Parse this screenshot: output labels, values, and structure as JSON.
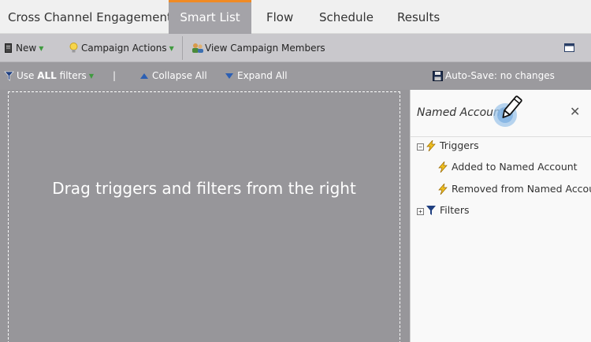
{
  "tabs": [
    {
      "label": "Cross Channel Engagement",
      "active": false
    },
    {
      "label": "Smart List",
      "active": true
    },
    {
      "label": "Flow",
      "active": false
    },
    {
      "label": "Schedule",
      "active": false
    },
    {
      "label": "Results",
      "active": false
    }
  ],
  "toolbar": {
    "new_label": "New",
    "campaign_actions_label": "Campaign Actions",
    "view_members_label": "View Campaign Members"
  },
  "filterbar": {
    "use_prefix": "Use ",
    "use_bold": "ALL",
    "use_suffix": " filters",
    "separator": "|",
    "collapse_label": "Collapse All",
    "expand_label": "Expand All",
    "autosave_label": "Auto-Save: no changes"
  },
  "canvas": {
    "drop_text": "Drag triggers and filters from the right"
  },
  "panel": {
    "search_value": "Named Account",
    "triggers_label": "Triggers",
    "trigger_items": [
      "Added to Named Account",
      "Removed from Named Account"
    ],
    "filters_label": "Filters"
  },
  "colors": {
    "accent_tab": "#f08a24",
    "dropdown_arrow": "#3f9a3f",
    "collapse_arrow": "#2c5fb3"
  },
  "icons": {
    "new": "document-icon",
    "campaign_actions": "lightbulb-icon",
    "view_members": "people-icon",
    "filter": "funnel-icon",
    "autosave": "floppy-disk-icon",
    "trigger": "lightning-bolt-icon",
    "pencil": "pencil-icon",
    "close": "close-icon"
  }
}
